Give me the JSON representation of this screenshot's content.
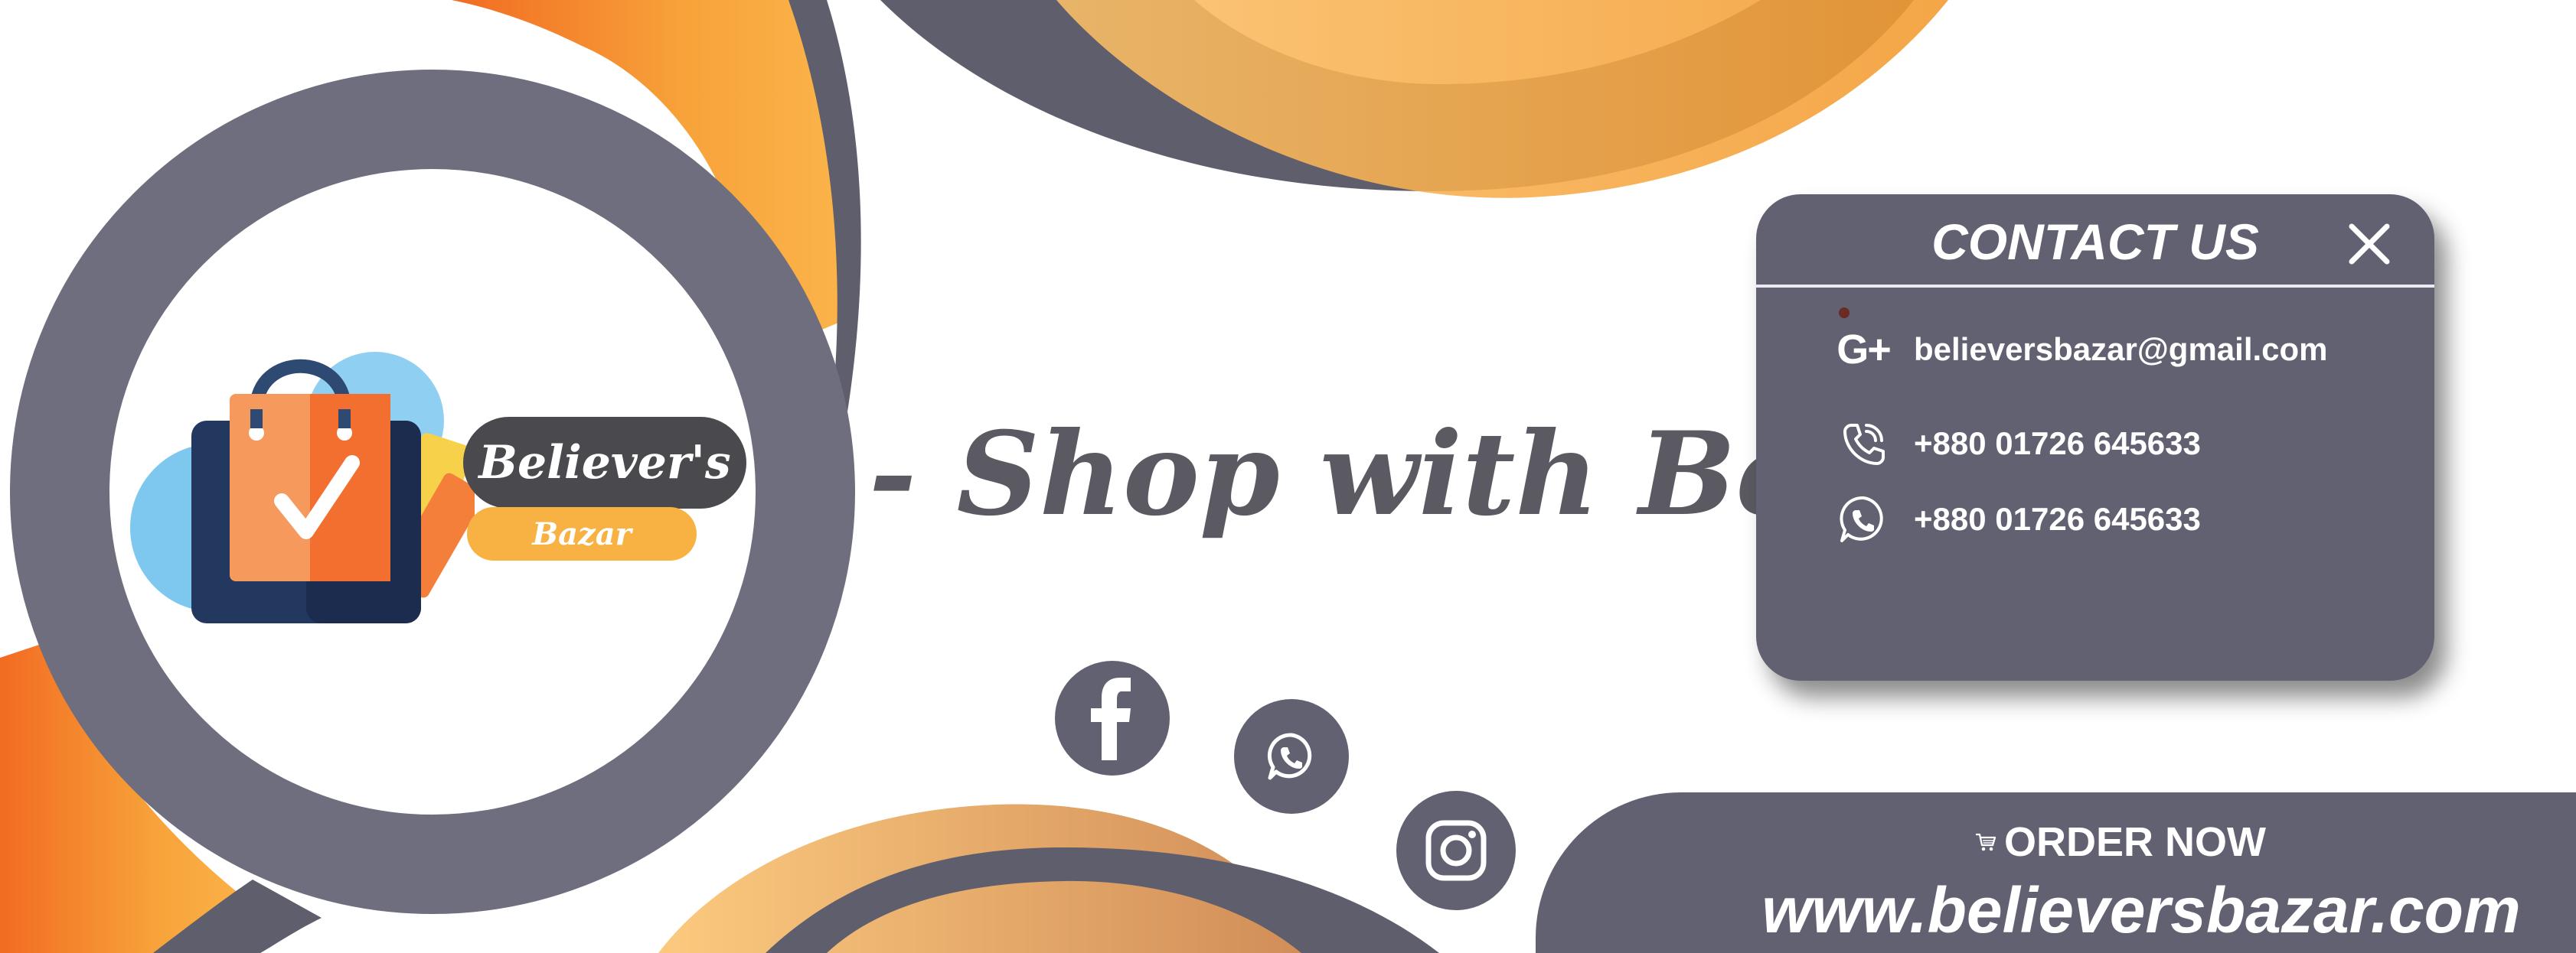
{
  "logo": {
    "line1": "Believer's",
    "line2": "Bazar"
  },
  "tagline": "- Shop with Believe",
  "contact": {
    "title": "CONTACT US",
    "email_icon": "google-plus-icon",
    "email_icon_glyph": "G+",
    "email": "believersbazar@gmail.com",
    "phone": "+880 01726 645633",
    "whatsapp": "+880 01726 645633"
  },
  "social": [
    "facebook-icon",
    "whatsapp-icon",
    "instagram-icon"
  ],
  "order": {
    "label": "ORDER NOW",
    "url": "www.believersbazar.com"
  },
  "colors": {
    "gray": "#626171",
    "ring_gray": "#6e6e7e",
    "orange": "#f7a33a",
    "orange_deep": "#f26b22",
    "orange_light": "#fbc068",
    "white": "#ffffff"
  }
}
